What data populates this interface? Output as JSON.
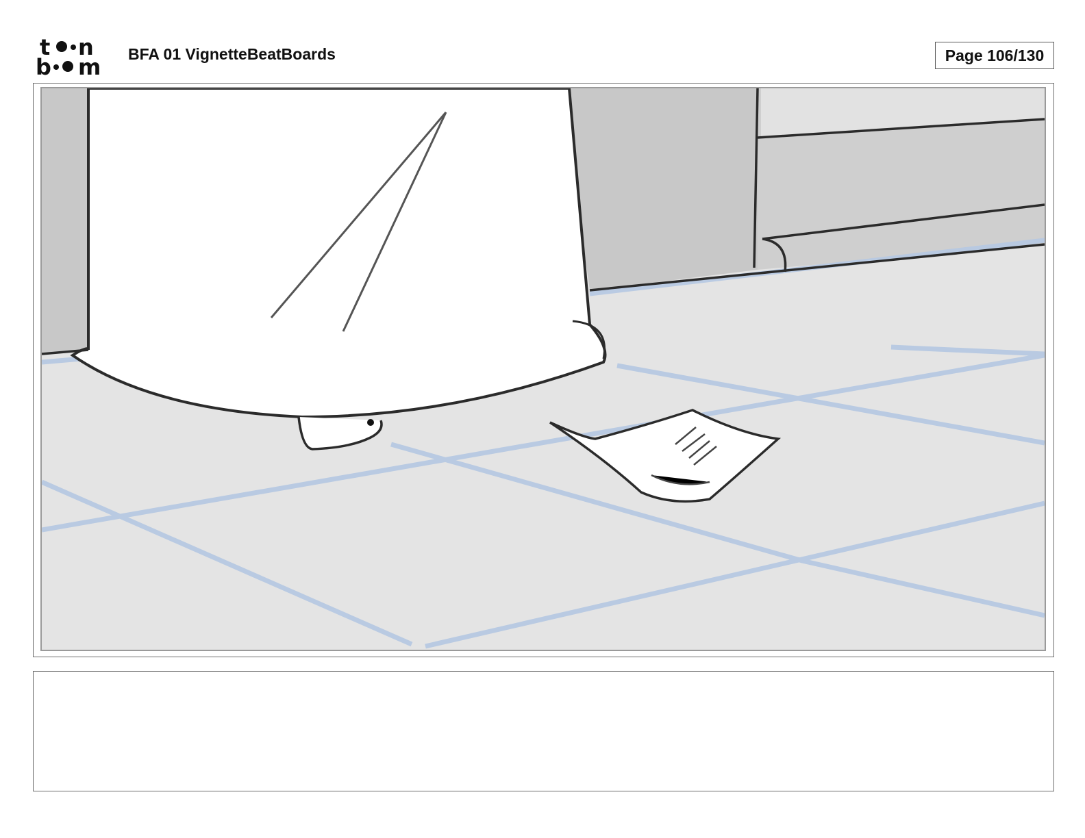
{
  "header": {
    "logo_text": "toonboom",
    "title": "BFA 01 VignetteBeatBoards",
    "page_label": "Page 106/130"
  },
  "panel": {
    "icon": "storyboard-sketch-floor-dress-paper"
  },
  "notes": {
    "text": ""
  },
  "colors": {
    "frame": "#6a6a6a",
    "floor": "#e4e4e4",
    "wall": "#c8c8c8",
    "tile_lines": "#b5c8e2",
    "sketch": "#2b2b2b"
  }
}
